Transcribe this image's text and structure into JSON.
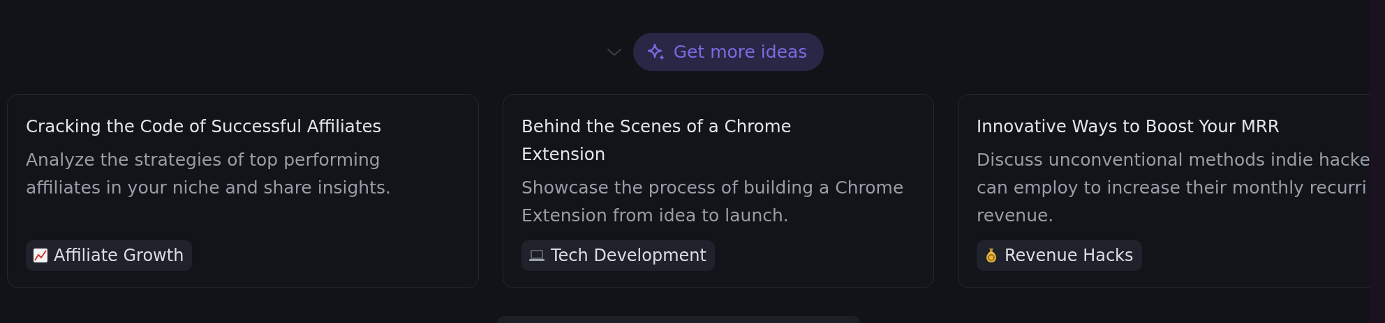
{
  "more_button": {
    "label": "Get more ideas"
  },
  "cards": [
    {
      "title_lines": [
        "Cracking the Code of Successful Affiliates"
      ],
      "description_lines": [
        "Analyze the strategies of top performing",
        "affiliates in your niche and share insights."
      ],
      "tag": {
        "kind": "chart",
        "label": "Affiliate Growth"
      }
    },
    {
      "title_lines": [
        "Behind the Scenes of a Chrome",
        "Extension"
      ],
      "description_lines": [
        "Showcase the process of building a Chrome",
        "Extension from idea to launch."
      ],
      "tag": {
        "kind": "laptop",
        "label": "Tech Development"
      }
    },
    {
      "title_lines": [
        "Innovative Ways to Boost Your MRR"
      ],
      "description_lines": [
        "Discuss unconventional methods indie hacke",
        "can employ to increase their monthly recurri",
        "revenue."
      ],
      "tag": {
        "kind": "money",
        "label": "Revenue Hacks"
      }
    }
  ]
}
